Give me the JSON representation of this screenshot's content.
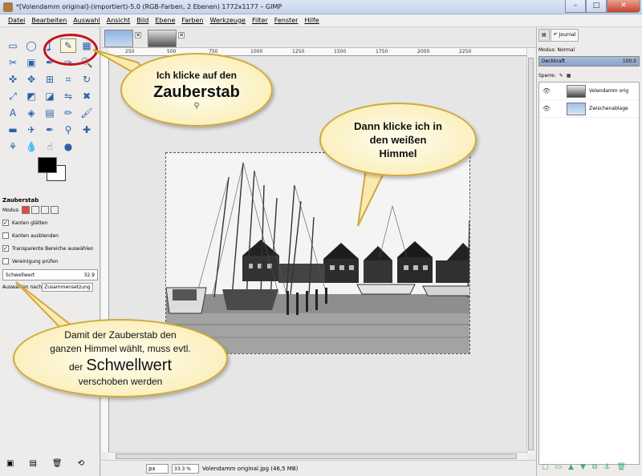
{
  "window": {
    "title": "*[Volendamm original]-(importiert)-5.0 (RGB-Farben, 2 Ebenen) 1772x1177 – GIMP",
    "minimize": "–",
    "maximize": "□",
    "close": "✕"
  },
  "menu": [
    "Datei",
    "Bearbeiten",
    "Auswahl",
    "Ansicht",
    "Bild",
    "Ebene",
    "Farben",
    "Werkzeuge",
    "Filter",
    "Fenster",
    "Hilfe"
  ],
  "toolbox": {
    "tools": [
      "rect-select-icon",
      "ellipse-select-icon",
      "lasso-icon",
      "fuzzy-select-icon",
      "select-by-color-icon",
      "scissors-icon",
      "foreground-select-icon",
      "paths-icon",
      "color-picker-icon",
      "zoom-icon",
      "measure-icon",
      "move-icon",
      "align-icon",
      "crop-icon",
      "rotate-icon",
      "scale-icon",
      "shear-icon",
      "perspective-icon",
      "flip-icon",
      "cage-icon",
      "text-icon",
      "bucket-fill-icon",
      "blend-icon",
      "pencil-icon",
      "paintbrush-icon",
      "eraser-icon",
      "airbrush-icon",
      "ink-icon",
      "clone-icon",
      "heal-icon",
      "perspective-clone-icon",
      "blur-icon",
      "smudge-icon",
      "dodge-burn-icon",
      "none"
    ],
    "tool_glyphs": [
      "▭",
      "◯",
      "ʆ",
      "✎",
      "▦",
      "✂",
      "▣",
      "✒",
      "✑",
      "🔍",
      "✜",
      "✥",
      "⊞",
      "⌗",
      "↻",
      "⤢",
      "◩",
      "◪",
      "⇋",
      "✖",
      "A",
      "◈",
      "▤",
      "✏",
      "🖌",
      "▬",
      "✈",
      "✒",
      "⚲",
      "✚",
      "⚘",
      "💧",
      "☝",
      "●",
      ""
    ],
    "options_title": "Zauberstab",
    "mode_label": "Modus:",
    "opt_antialias": "Kanten glätten",
    "opt_feather": "Kanten ausblenden",
    "opt_transparent": "Transparente Bereiche auswählen",
    "opt_merged": "Vereinigung prüfen",
    "threshold_label": "Schwellwert",
    "threshold_value": "32.9",
    "select_by_label": "Auswählen nach",
    "select_by_value": "Zusammensetzung"
  },
  "ruler": {
    "ticks": [
      "250",
      "500",
      "750",
      "1000",
      "1250",
      "1500",
      "1750",
      "2000",
      "2250"
    ]
  },
  "status": {
    "unit": "px",
    "zoom": "33.3 %",
    "file": "Volendamm original.jpg (46,5 MB)"
  },
  "dock": {
    "tab_journal": "Journal",
    "mode_label": "Modus: Normal",
    "opacity_label": "Deckkraft",
    "opacity_value": "100.0",
    "lock_label": "Sperre:",
    "layers": [
      {
        "name": "Volendamm orig"
      },
      {
        "name": "Zwischenablage"
      }
    ]
  },
  "callouts": {
    "c1_line1": "Ich klicke auf den",
    "c1_big": "Zauberstab",
    "c2_line1": "Dann klicke ich in",
    "c2_line2": "den weißen",
    "c2_line3": "Himmel",
    "c3_line1": "Damit der Zauberstab den",
    "c3_line2": "ganzen Himmel wählt, muss evtl.",
    "c3_line3a": "der",
    "c3_big": "Schwellwert",
    "c3_line4": "verschoben werden"
  }
}
